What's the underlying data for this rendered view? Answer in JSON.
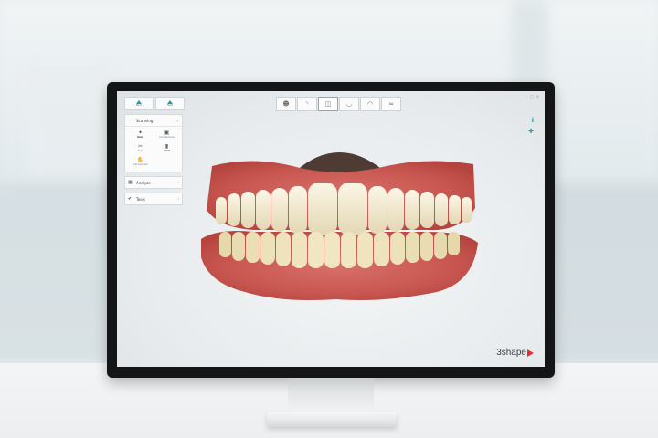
{
  "colors": {
    "accent": "#1a9fa4",
    "logo_mark": "#e0312f"
  },
  "top_buttons": [
    {
      "label": "Back",
      "icon": "arrow-up-icon"
    },
    {
      "label": "Next",
      "icon": "arrow-up-icon"
    }
  ],
  "panel": {
    "scanning": {
      "label": "Scanning",
      "tools": [
        {
          "label": "Scan",
          "icon": "scan-wand-icon"
        },
        {
          "label": "Lock Remove",
          "icon": "lock-image-icon"
        },
        {
          "label": "Trim",
          "icon": "trim-scissors-icon"
        },
        {
          "label": "Clear",
          "icon": "clear-icon"
        },
        {
          "label": "Add Scanned",
          "icon": "hand-icon"
        }
      ]
    },
    "analyze": {
      "label": "Analyze"
    },
    "tools": {
      "label": "Tools"
    }
  },
  "toolbar": {
    "items": [
      "face-view-icon",
      "jaw-side-view-icon",
      "both-jaws-icon",
      "lower-jaw-icon",
      "upper-jaw-icon",
      "bite-view-icon"
    ],
    "active_index": 2
  },
  "right_icons": [
    "info-icon",
    "crosshair-icon"
  ],
  "brand": {
    "name": "3shape"
  }
}
